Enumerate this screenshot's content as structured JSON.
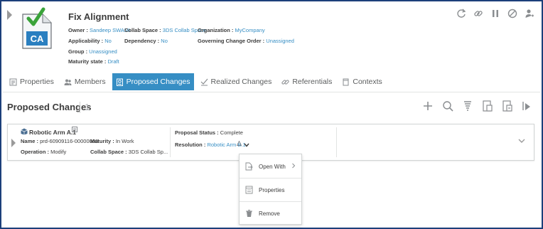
{
  "header": {
    "title": "Fix Alignment",
    "ca_label": "CA",
    "owner_label": "Owner :",
    "owner_value": "Sandeep SWAMI",
    "collab_label": "Collab Space :",
    "collab_value": "3DS Collab Space",
    "org_label": "Organization :",
    "org_value": "MyCompany",
    "applicability_label": "Applicability :",
    "applicability_value": "No",
    "dependency_label": "Dependency :",
    "dependency_value": "No",
    "gco_label": "Governing Change Order :",
    "gco_value": "Unassigned",
    "group_label": "Group :",
    "group_value": "Unassigned",
    "maturity_label": "Maturity state :",
    "maturity_value": "Draft"
  },
  "tabs": [
    {
      "label": "Properties",
      "icon": "properties-icon"
    },
    {
      "label": "Members",
      "icon": "members-icon"
    },
    {
      "label": "Proposed Changes",
      "icon": "proposed-changes-icon"
    },
    {
      "label": "Realized Changes",
      "icon": "realized-changes-icon"
    },
    {
      "label": "Referentials",
      "icon": "referentials-icon"
    },
    {
      "label": "Contexts",
      "icon": "contexts-icon"
    }
  ],
  "section": {
    "title": "Proposed Changes",
    "count": "1"
  },
  "card": {
    "title": "Robotic Arm A.1",
    "name_label": "Name :",
    "name_value": "prd-60909116-00000003",
    "maturity_label": "Maturity :",
    "maturity_value": "In Work",
    "operation_label": "Operation :",
    "operation_value": "Modify",
    "collab_label": "Collab Space :",
    "collab_value": "3DS Collab Sp...",
    "status_label": "Proposal Status :",
    "status_value": "Complete",
    "resolution_label": "Resolution :",
    "resolution_value": "Robotic Arm B.1"
  },
  "menu": {
    "items": [
      {
        "label": "Open With",
        "icon": "open-with-icon"
      },
      {
        "label": "Properties",
        "icon": "properties-icon"
      },
      {
        "label": "Remove",
        "icon": "trash-icon"
      }
    ]
  },
  "colors": {
    "accent": "#368ec4",
    "frame": "#1c3f7a",
    "text": "#3d3d3d",
    "muted": "#9a9a9a",
    "check_green": "#3aa33a"
  }
}
